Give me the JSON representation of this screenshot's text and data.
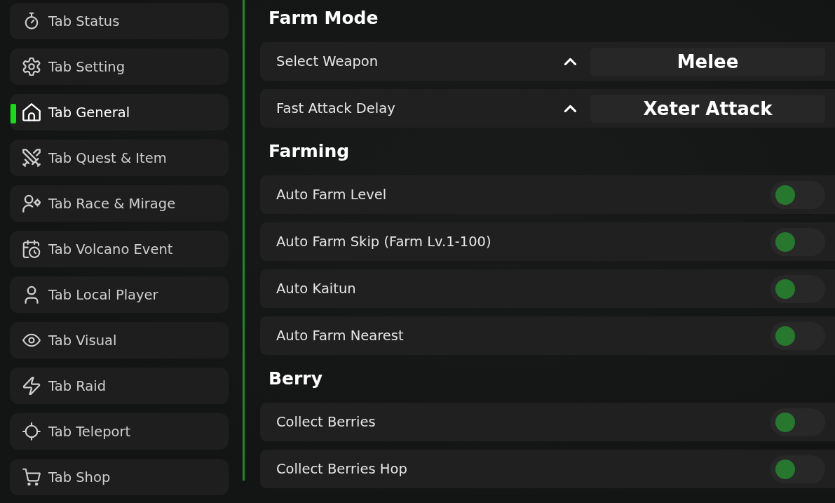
{
  "sidebar": {
    "items": [
      {
        "label": "Tab Status",
        "selected": false
      },
      {
        "label": "Tab Setting",
        "selected": false
      },
      {
        "label": "Tab General",
        "selected": true
      },
      {
        "label": "Tab Quest & Item",
        "selected": false
      },
      {
        "label": "Tab Race & Mirage",
        "selected": false
      },
      {
        "label": "Tab Volcano Event",
        "selected": false
      },
      {
        "label": "Tab Local Player",
        "selected": false
      },
      {
        "label": "Tab Visual",
        "selected": false
      },
      {
        "label": "Tab Raid",
        "selected": false
      },
      {
        "label": "Tab Teleport",
        "selected": false
      },
      {
        "label": "Tab Shop",
        "selected": false
      }
    ]
  },
  "sections": [
    {
      "title": "Farm Mode",
      "options": [
        {
          "kind": "dropdown",
          "label": "Select Weapon",
          "value": "Melee"
        },
        {
          "kind": "dropdown",
          "label": "Fast Attack Delay",
          "value": "Xeter Attack"
        }
      ]
    },
    {
      "title": "Farming",
      "options": [
        {
          "kind": "toggle",
          "label": "Auto Farm Level",
          "on": false
        },
        {
          "kind": "toggle",
          "label": "Auto Farm Skip (Farm Lv.1-100)",
          "on": false
        },
        {
          "kind": "toggle",
          "label": "Auto Kaitun",
          "on": false
        },
        {
          "kind": "toggle",
          "label": "Auto Farm Nearest",
          "on": false
        }
      ]
    },
    {
      "title": "Berry",
      "options": [
        {
          "kind": "toggle",
          "label": "Collect Berries",
          "on": false
        },
        {
          "kind": "toggle",
          "label": "Collect Berries Hop",
          "on": false
        }
      ]
    }
  ]
}
